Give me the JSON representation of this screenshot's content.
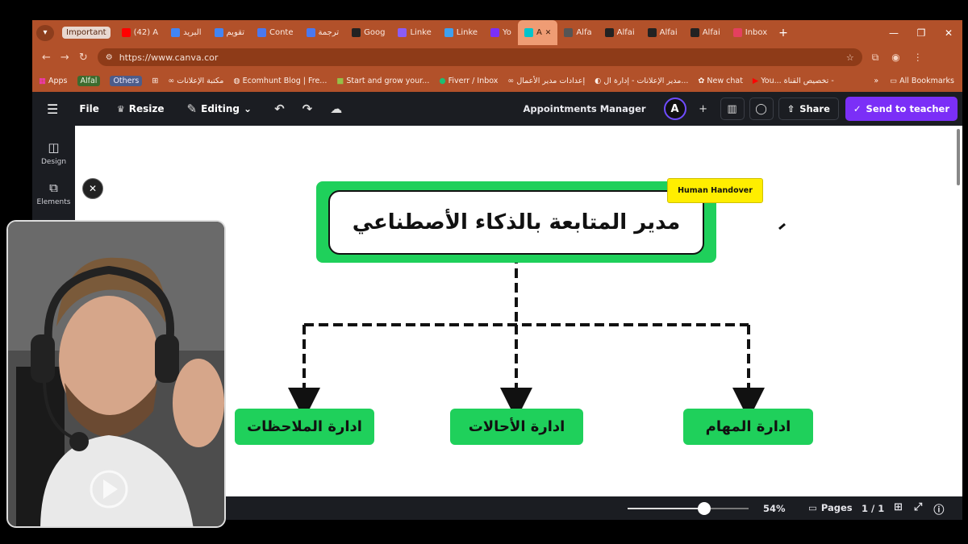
{
  "browser": {
    "tab_group_label": "Important",
    "tabs": [
      {
        "label": "(42) A",
        "color": "#ff0000"
      },
      {
        "label": "البريد",
        "color": "#4285f4"
      },
      {
        "label": "تقويم",
        "color": "#4285f4"
      },
      {
        "label": "Conte",
        "color": "#4a78f0"
      },
      {
        "label": "ترجمة",
        "color": "#4a78f0"
      },
      {
        "label": "Goog",
        "color": "#222222"
      },
      {
        "label": "Linke",
        "color": "#8a5cf6"
      },
      {
        "label": "Linke",
        "color": "#3da0f0"
      },
      {
        "label": "Yo",
        "color": "#7b2ff7"
      },
      {
        "label": "A",
        "color": "#00c4cc"
      },
      {
        "label": "Alfa",
        "color": "#555555"
      },
      {
        "label": "Alfai",
        "color": "#222222"
      },
      {
        "label": "Alfai",
        "color": "#222222"
      },
      {
        "label": "Alfai",
        "color": "#222222"
      },
      {
        "label": "Inbox",
        "color": "#e4405f"
      }
    ],
    "url": "https://www.canva.cor",
    "bookmarks": [
      "Apps",
      "Alfal",
      "Others",
      "مكتبة الإعلانات",
      "Ecomhunt Blog | Fre...",
      "Start and grow your...",
      "Fiverr / Inbox",
      "إعدادات مدير الأعمال",
      "مدير الإعلانات - إدارة ال...",
      "New chat",
      "You...",
      "تخصيص القناة -"
    ],
    "all_bookmarks": "All Bookmarks"
  },
  "toolbar": {
    "file": "File",
    "resize": "Resize",
    "editing": "Editing",
    "title": "Appointments Manager",
    "share": "Share",
    "send_to_teacher": "Send to teacher"
  },
  "sidebar": {
    "design": "Design",
    "elements": "Elements"
  },
  "diagram": {
    "main": "مدير المتابعة بالذكاء الأصطناعي",
    "tag": "Human Handover",
    "children": [
      "ادارة الملاحظات",
      "ادارة الأحالات",
      "ادارة المهام"
    ]
  },
  "footer": {
    "zoom": "54%",
    "pages": "Pages",
    "page_num": "1 / 1",
    "zoom_level": 0.63
  },
  "colors": {
    "accent_green": "#1fd05b",
    "tag_yellow": "#ffee00",
    "canva_purple": "#7b2ff7",
    "browser_chrome": "#b2512a"
  }
}
